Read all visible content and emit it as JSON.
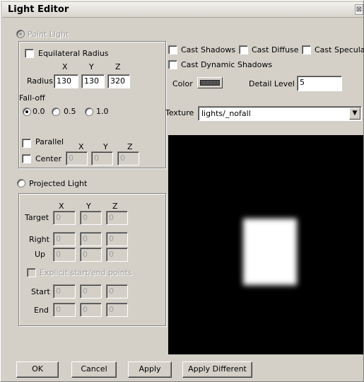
{
  "window": {
    "title": "Light Editor",
    "close_glyph": "⊠"
  },
  "point_light": {
    "radio_label": "Point Light",
    "equilateral_label": "Equilateral Radius",
    "axis_labels": [
      "X",
      "Y",
      "Z"
    ],
    "radius_label": "Radius",
    "radius": {
      "x": "130",
      "y": "130",
      "z": "320"
    },
    "falloff_label": "Fall-off",
    "falloff_options": [
      "0.0",
      "0.5",
      "1.0"
    ],
    "parallel_label": "Parallel",
    "center_label": "Center",
    "center": {
      "x": "0",
      "y": "0",
      "z": "0"
    }
  },
  "projected_light": {
    "radio_label": "Projected Light",
    "axis_labels": [
      "X",
      "Y",
      "Z"
    ],
    "target_label": "Target",
    "right_label": "Right",
    "up_label": "Up",
    "explicit_label": "Explicit start/end points",
    "start_label": "Start",
    "end_label": "End",
    "target": {
      "x": "0",
      "y": "0",
      "z": "0"
    },
    "right": {
      "x": "0",
      "y": "0",
      "z": "0"
    },
    "up": {
      "x": "0",
      "y": "0",
      "z": "0"
    },
    "start": {
      "x": "0",
      "y": "0",
      "z": "0"
    },
    "end": {
      "x": "0",
      "y": "0",
      "z": "0"
    }
  },
  "options": {
    "cast_shadows": "Cast Shadows",
    "cast_diffuse": "Cast Diffuse",
    "cast_specular": "Cast Specular",
    "cast_dynamic_shadows": "Cast Dynamic Shadows",
    "color_label": "Color",
    "detail_level_label": "Detail Level",
    "detail_level": "5",
    "texture_label": "Texture",
    "texture_value": "lights/_nofall"
  },
  "buttons": {
    "ok": "OK",
    "cancel": "Cancel",
    "apply": "Apply",
    "apply_different": "Apply Different"
  },
  "colors": {
    "dialog_bg": "#d4d0c8",
    "preview_bg": "#000000",
    "light": "#ffffff"
  }
}
